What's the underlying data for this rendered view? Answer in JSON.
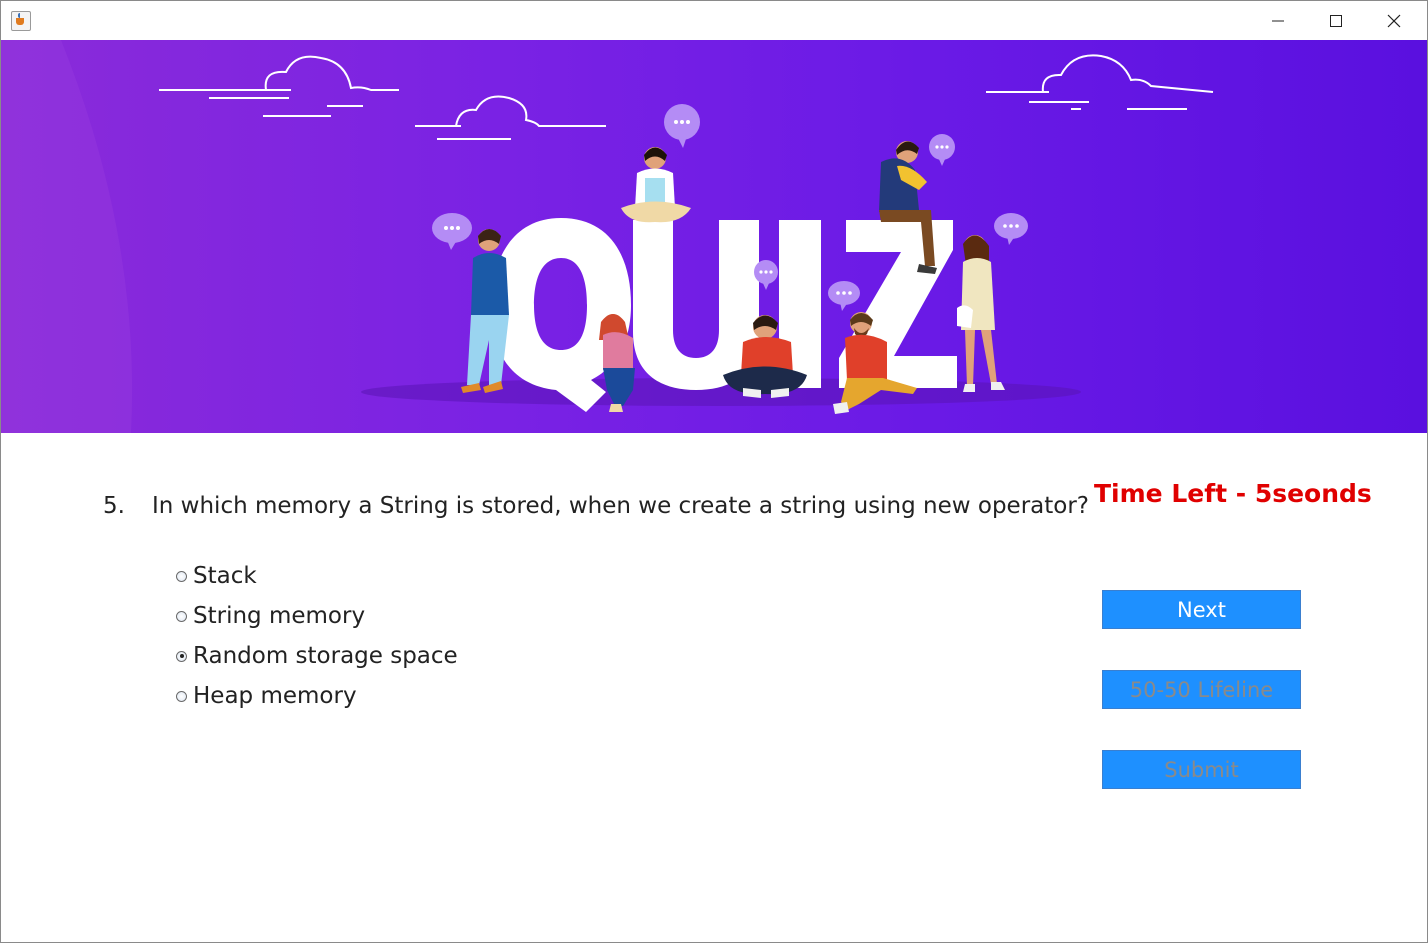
{
  "window": {
    "controls": [
      "minimize-icon",
      "maximize-icon",
      "close-icon"
    ]
  },
  "banner": {
    "title_letters": [
      "Q",
      "U",
      "I",
      "Z"
    ],
    "colors": {
      "gradient_start": "#8a2bd9",
      "gradient_end": "#5a10df",
      "bubble": "#b48cf5"
    }
  },
  "question": {
    "number": "5.",
    "text": "In which memory a String is stored, when we create a string using new operator?"
  },
  "timer": {
    "text": "Time Left - 5seonds",
    "color": "#e00000"
  },
  "options": [
    {
      "label": "Stack",
      "selected": false
    },
    {
      "label": "String memory",
      "selected": false
    },
    {
      "label": "Random storage space",
      "selected": true
    },
    {
      "label": "Heap memory",
      "selected": false
    }
  ],
  "buttons": {
    "next": {
      "label": "Next",
      "enabled": true
    },
    "lifeline": {
      "label": "50-50 Lifeline",
      "enabled": false
    },
    "submit": {
      "label": "Submit",
      "enabled": false
    }
  }
}
